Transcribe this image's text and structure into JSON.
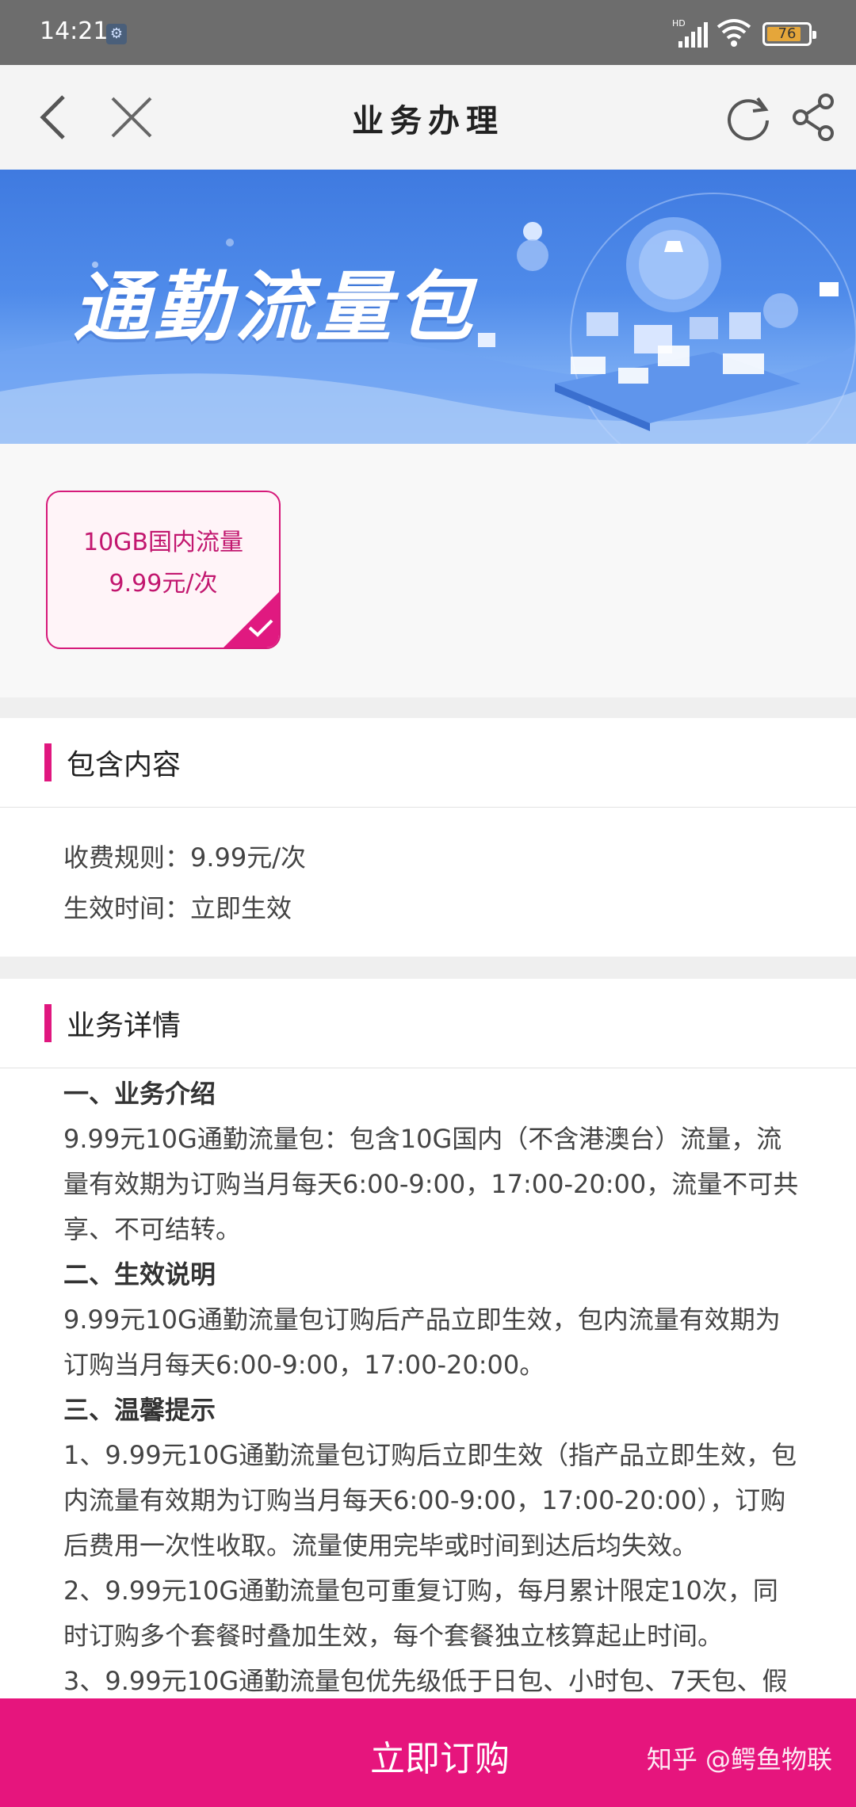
{
  "status_bar": {
    "time": "14:21",
    "network_label": "HD",
    "battery_level": "76"
  },
  "navbar": {
    "title": "业务办理"
  },
  "banner": {
    "title": "通勤流量包"
  },
  "package_card": {
    "line1": "10GB国内流量",
    "line2": "9.99元/次",
    "selected": true
  },
  "includes_section": {
    "title": "包含内容",
    "fee_rule": "收费规则：9.99元/次",
    "effective_time": "生效时间：立即生效"
  },
  "details_section": {
    "title": "业务详情",
    "blocks": [
      {
        "type": "heading",
        "text": "一、业务介绍"
      },
      {
        "type": "para",
        "text": "9.99元10G通勤流量包：包含10G国内（不含港澳台）流量，流量有效期为订购当月每天6:00-9:00，17:00-20:00，流量不可共享、不可结转。"
      },
      {
        "type": "heading",
        "text": "二、生效说明"
      },
      {
        "type": "para",
        "text": "9.99元10G通勤流量包订购后产品立即生效，包内流量有效期为订购当月每天6:00-9:00，17:00-20:00。"
      },
      {
        "type": "heading",
        "text": "三、温馨提示"
      },
      {
        "type": "para",
        "text": "1、9.99元10G通勤流量包订购后立即生效（指产品立即生效，包内流量有效期为订购当月每天6:00-9:00，17:00-20:00），订购后费用一次性收取。流量使用完毕或时间到达后均失效。"
      },
      {
        "type": "para",
        "text": "2、9.99元10G通勤流量包可重复订购，每月累计限定10次，同时订购多个套餐时叠加生效，每个套餐独立核算起止时间。"
      },
      {
        "type": "para",
        "text": "3、9.99元10G通勤流量包优先级低于日包、小时包、7天包、假"
      }
    ]
  },
  "buy_bar": {
    "button_label": "立即订购",
    "watermark": "知乎 @鳄鱼物联"
  },
  "colors": {
    "accent": "#e6157d",
    "banner_blue": "#4f8bea"
  }
}
